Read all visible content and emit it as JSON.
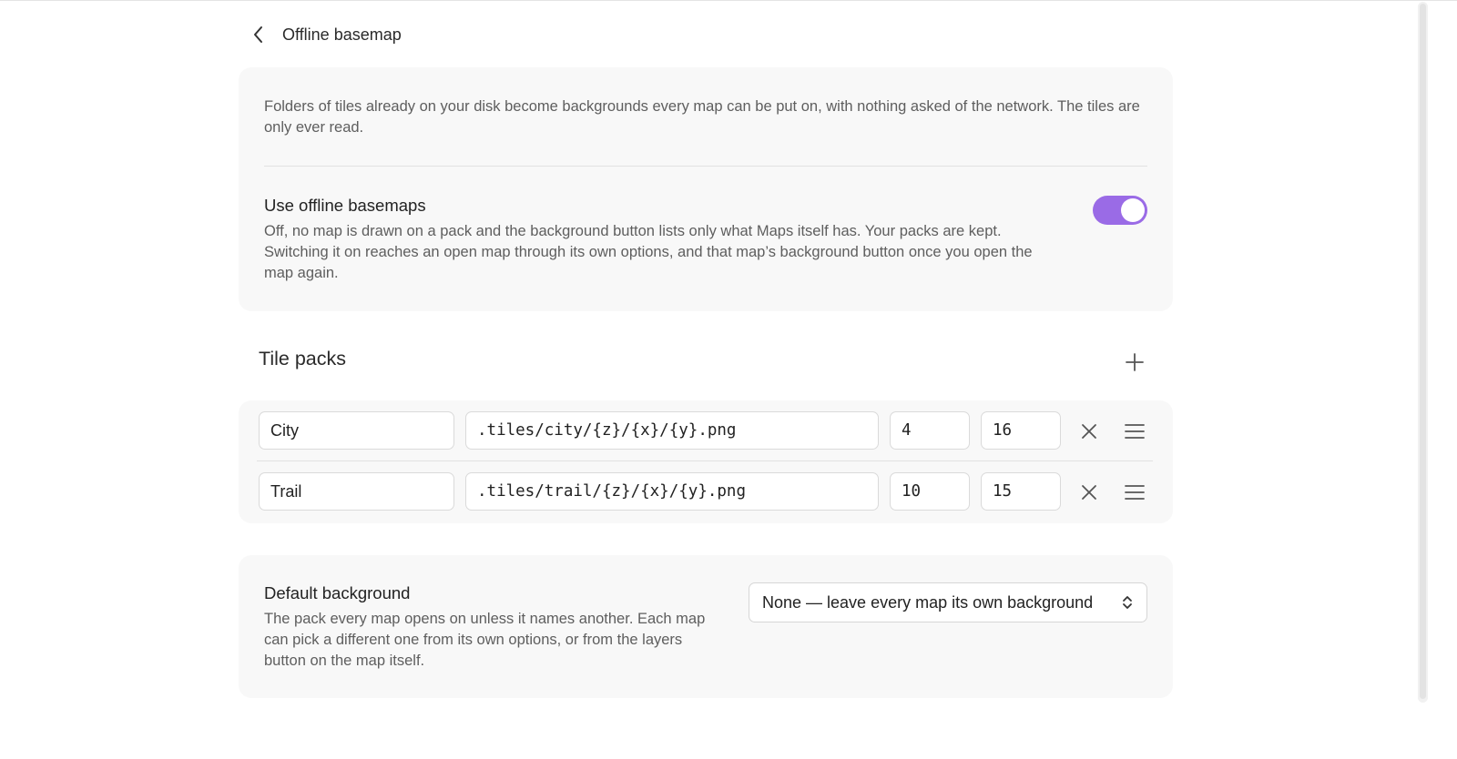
{
  "header": {
    "title": "Offline basemap",
    "back_icon": "chevron-left-icon"
  },
  "offline": {
    "intro": "Folders of tiles already on your disk become backgrounds every map can be put on, with nothing asked of the network. The tiles are only ever read.",
    "setting_title": "Use offline basemaps",
    "setting_desc": "Off, no map is drawn on a pack and the background button lists only what Maps itself has. Your packs are kept. Switching it on reaches an open map through its own options, and that map’s background button once you open the map again.",
    "toggle_on": true,
    "accent_color": "#9a6be6"
  },
  "tile_packs": {
    "title": "Tile packs",
    "add_icon": "plus-icon",
    "rows": [
      {
        "name": "City",
        "path": ".tiles/city/{z}/{x}/{y}.png",
        "min_zoom": "4",
        "max_zoom": "16"
      },
      {
        "name": "Trail",
        "path": ".tiles/trail/{z}/{x}/{y}.png",
        "min_zoom": "10",
        "max_zoom": "15"
      }
    ],
    "remove_icon": "close-icon",
    "drag_icon": "drag-handle-icon"
  },
  "default_background": {
    "title": "Default background",
    "desc": "The pack every map opens on unless it names another. Each map can pick a different one from its own options, or from the layers button on the map itself.",
    "selected": "None — leave every map its own background",
    "select_icon": "updown-chevron-icon"
  }
}
